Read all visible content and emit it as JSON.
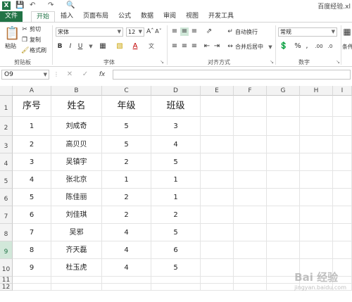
{
  "app": {
    "title": "百度经验.xl",
    "qat_icons": [
      "excel-logo-icon",
      "save-icon",
      "undo-icon",
      "redo-icon",
      "print-preview-icon"
    ]
  },
  "tabs": [
    {
      "label": "文件",
      "name": "tab-file"
    },
    {
      "label": "开始",
      "name": "tab-home"
    },
    {
      "label": "插入",
      "name": "tab-insert"
    },
    {
      "label": "页面布局",
      "name": "tab-page-layout"
    },
    {
      "label": "公式",
      "name": "tab-formulas"
    },
    {
      "label": "数据",
      "name": "tab-data"
    },
    {
      "label": "审阅",
      "name": "tab-review"
    },
    {
      "label": "视图",
      "name": "tab-view"
    },
    {
      "label": "开发工具",
      "name": "tab-developer"
    }
  ],
  "ribbon": {
    "clipboard": {
      "paste": "粘贴",
      "cut": "剪切",
      "copy": "复制",
      "format_painter": "格式刷",
      "label": "剪贴板"
    },
    "font": {
      "name": "宋体",
      "size": "12",
      "label": "字体",
      "bold": "B",
      "italic": "I",
      "underline": "U"
    },
    "alignment": {
      "wrap": "自动换行",
      "merge": "合并后居中",
      "label": "对齐方式"
    },
    "number": {
      "format": "常规",
      "label": "数字",
      "percent": "%",
      "comma": ","
    },
    "styles": {
      "conditional": "条件"
    }
  },
  "formula_bar": {
    "name_box": "O9",
    "fx": "fx",
    "value": ""
  },
  "columns": [
    "A",
    "B",
    "C",
    "D",
    "E",
    "F",
    "G",
    "H",
    "I"
  ],
  "rows": [
    "1",
    "2",
    "3",
    "4",
    "5",
    "6",
    "7",
    "8",
    "9",
    "10",
    "11",
    "12"
  ],
  "table": {
    "headers": [
      "序号",
      "姓名",
      "年级",
      "班级"
    ],
    "data": [
      [
        "1",
        "刘成奇",
        "5",
        "3"
      ],
      [
        "2",
        "高贝贝",
        "5",
        "4"
      ],
      [
        "3",
        "吴镇宇",
        "2",
        "5"
      ],
      [
        "4",
        "张北京",
        "1",
        "1"
      ],
      [
        "5",
        "陈佳丽",
        "2",
        "1"
      ],
      [
        "6",
        "刘佳琪",
        "2",
        "2"
      ],
      [
        "7",
        "吴邪",
        "4",
        "5"
      ],
      [
        "8",
        "齐天磊",
        "4",
        "6"
      ],
      [
        "9",
        "杜玉虎",
        "4",
        "5"
      ]
    ]
  },
  "watermark": {
    "text": "Bai 经验",
    "sub": "jingyan.baidu.com"
  }
}
